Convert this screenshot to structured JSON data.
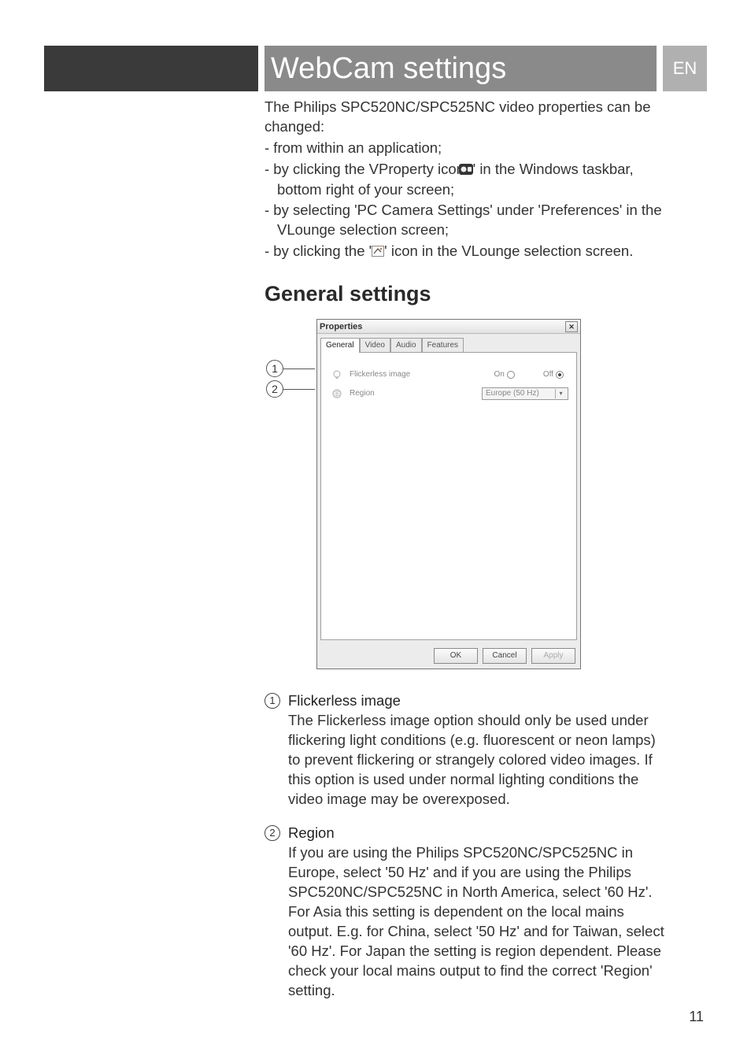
{
  "header": {
    "title": "WebCam settings",
    "lang": "EN"
  },
  "intro": {
    "lead": "The Philips SPC520NC/SPC525NC video properties can be changed:",
    "items": [
      "- from within an application;",
      "- by clicking the VProperty icon '   ' in the Windows taskbar, bottom right of your screen;",
      "- by selecting 'PC Camera Settings' under 'Preferences' in the VLounge selection screen;",
      "- by clicking the '   ' icon in the VLounge selection screen."
    ]
  },
  "section_title": "General settings",
  "dialog": {
    "title": "Properties",
    "tabs": [
      "General",
      "Video",
      "Audio",
      "Features"
    ],
    "active_tab": 0,
    "row1": {
      "label": "Flickerless image",
      "on_label": "On",
      "off_label": "Off",
      "selected": "Off"
    },
    "row2": {
      "label": "Region",
      "value": "Europe (50 Hz)"
    },
    "buttons": {
      "ok": "OK",
      "cancel": "Cancel",
      "apply": "Apply"
    }
  },
  "callouts": [
    "1",
    "2"
  ],
  "explanations": [
    {
      "num": "1",
      "label": "Flickerless image",
      "text": "The Flickerless image option should only be used under flickering light conditions (e.g. fluorescent or neon lamps) to prevent flickering or strangely colored video images. If this option is used under normal lighting conditions the video image may be overexposed."
    },
    {
      "num": "2",
      "label": "Region",
      "text": "If you are using the Philips SPC520NC/SPC525NC in Europe, select '50 Hz' and if you are using the Philips SPC520NC/SPC525NC in North America, select '60 Hz'. For Asia this setting is dependent on the local mains output. E.g. for China, select '50 Hz' and for Taiwan, select '60 Hz'. For Japan the setting is region dependent. Please check your local mains output to find the correct 'Region' setting."
    }
  ],
  "page_number": "11"
}
